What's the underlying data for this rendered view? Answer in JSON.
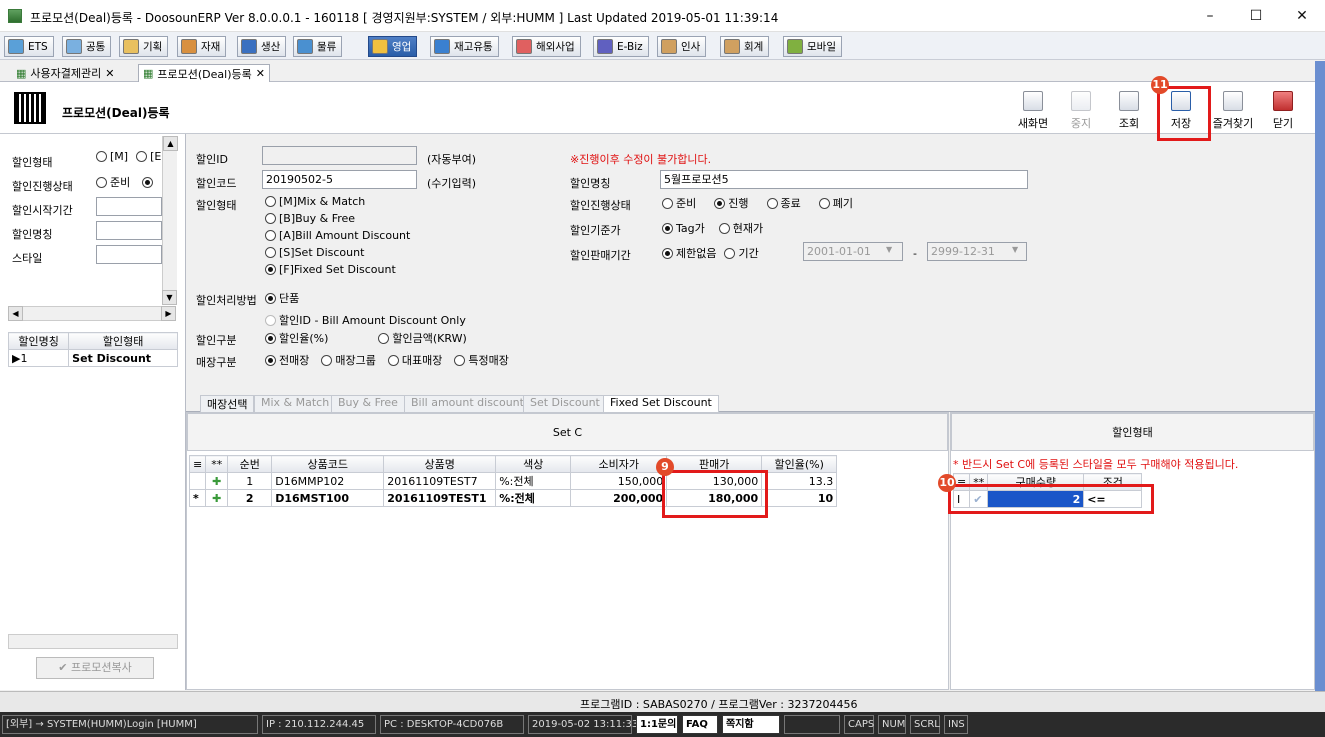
{
  "window": {
    "title": "프로모션(Deal)등록 - DoosounERP Ver 8.0.0.0.1 - 160118 [ 경영지원부:SYSTEM / 외부:HUMM ]    Last Updated 2019-05-01 11:39:14"
  },
  "menu": [
    "ETS",
    "공통",
    "기획",
    "자재",
    "생산",
    "물류",
    "영업",
    "재고유통",
    "해외사업",
    "E-Biz",
    "인사",
    "회계",
    "모바일"
  ],
  "menu_active": "영업",
  "doc_tabs": [
    "사용자결제관리",
    "프로모션(Deal)등록"
  ],
  "page_title": "프로모션(Deal)등록",
  "toolbar": {
    "new": "새화면",
    "stop": "중지",
    "search": "조회",
    "save": "저장",
    "fav": "즐겨찾기",
    "close": "닫기"
  },
  "badges": {
    "b9": "9",
    "b10": "10",
    "b11": "11"
  },
  "left": {
    "labels": [
      "할인형태",
      "할인진행상태",
      "할인시작기간",
      "할인명칭",
      "스타일"
    ],
    "type_opts": [
      "[M]",
      "[E"
    ],
    "status_opts": [
      "준비"
    ],
    "grid_headers": [
      "할인명칭",
      "할인형태"
    ],
    "grid_row": {
      "col1": "▶1",
      "col2": "Set Discount"
    },
    "copy_btn": "프로모션복사"
  },
  "form": {
    "id_label": "할인ID",
    "id_value": "",
    "id_note": "(자동부여)",
    "warning": "※진행이후 수정이 불가합니다.",
    "code_label": "할인코드",
    "code_value": "20190502-5",
    "code_note": "(수기입력)",
    "name_label": "할인명칭",
    "name_value": "5월프로모션5",
    "type_label": "할인형태",
    "type_opts": [
      "[M]Mix & Match",
      "[B]Buy & Free",
      "[A]Bill Amount Discount",
      "[S]Set Discount",
      "[F]Fixed Set Discount"
    ],
    "status_label": "할인진행상태",
    "status_opts": [
      "준비",
      "진행",
      "종료",
      "폐기"
    ],
    "base_label": "할인기준가",
    "base_opts": [
      "Tag가",
      "현재가"
    ],
    "period_label": "할인판매기간",
    "period_opts": [
      "제한없음",
      "기간"
    ],
    "date_from": "2001-01-01",
    "date_sep": "-",
    "date_to": "2999-12-31",
    "proc_label": "할인처리방법",
    "proc_opts": [
      "단품",
      "할인ID - Bill Amount Discount Only"
    ],
    "div_label": "할인구분",
    "div_opts": [
      "할인율(%)",
      "할인금액(KRW)"
    ],
    "store_label": "매장구분",
    "store_opts": [
      "전매장",
      "매장그룹",
      "대표매장",
      "특정매장"
    ]
  },
  "sub_tabs": [
    "매장선택",
    "Mix & Match",
    "Buy & Free",
    "Bill amount discount",
    "Set Discount",
    "Fixed Set Discount"
  ],
  "setc": {
    "title": "Set C",
    "headers": [
      "**",
      "순번",
      "상품코드",
      "상품명",
      "색상",
      "소비자가",
      "판매가",
      "할인율(%)"
    ],
    "rows": [
      {
        "mark": "",
        "seq": "1",
        "code": "D16MMP102",
        "name": "20161109TEST7",
        "color": "%:전체",
        "retail": "150,000",
        "sale": "130,000",
        "rate": "13.3"
      },
      {
        "mark": "*",
        "seq": "2",
        "code": "D16MST100",
        "name": "20161109TEST1",
        "color": "%:전체",
        "retail": "200,000",
        "sale": "180,000",
        "rate": "10"
      }
    ]
  },
  "discount_type": {
    "title": "할인형태",
    "notice": "* 반드시 Set C에 등록된 스타일을 모두 구매해야 적용됩니다.",
    "headers": [
      "**",
      "구매수량",
      "조건"
    ],
    "row": {
      "qty": "2",
      "cond": "<="
    }
  },
  "status": {
    "program": "프로그램ID : SABAS0270 / 프로그램Ver : 3237204456",
    "cells": [
      "[외부] → SYSTEM(HUMM)Login [HUMM]",
      "IP : 210.112.244.45",
      "PC : DESKTOP-4CD076B",
      "2019-05-02 13:11:33",
      "1:1문의",
      "FAQ",
      "쪽지함",
      "",
      "CAPS",
      "NUM",
      "SCRL",
      "INS"
    ]
  }
}
